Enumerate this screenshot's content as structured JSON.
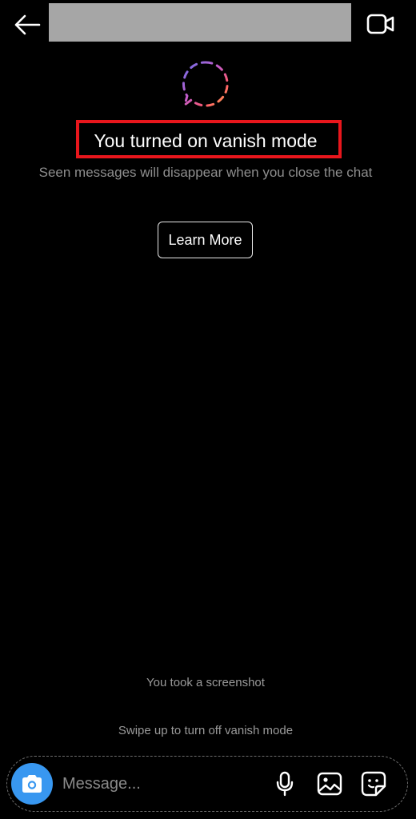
{
  "header": {
    "back_icon": "arrow-left-icon",
    "video_icon": "video-call-icon"
  },
  "vanish": {
    "icon": "vanish-mode-chat-bubble-icon",
    "title": "You turned on vanish mode",
    "description": "Seen messages will disappear when you close the chat",
    "learn_more_label": "Learn More",
    "highlight_color": "#e8161c"
  },
  "notices": {
    "screenshot": "You took a screenshot",
    "swipe": "Swipe up to turn off vanish mode"
  },
  "composer": {
    "placeholder": "Message...",
    "camera_icon": "camera-icon",
    "mic_icon": "microphone-icon",
    "gallery_icon": "image-gallery-icon",
    "sticker_icon": "sticker-icon",
    "accent_color": "#3897f0"
  }
}
